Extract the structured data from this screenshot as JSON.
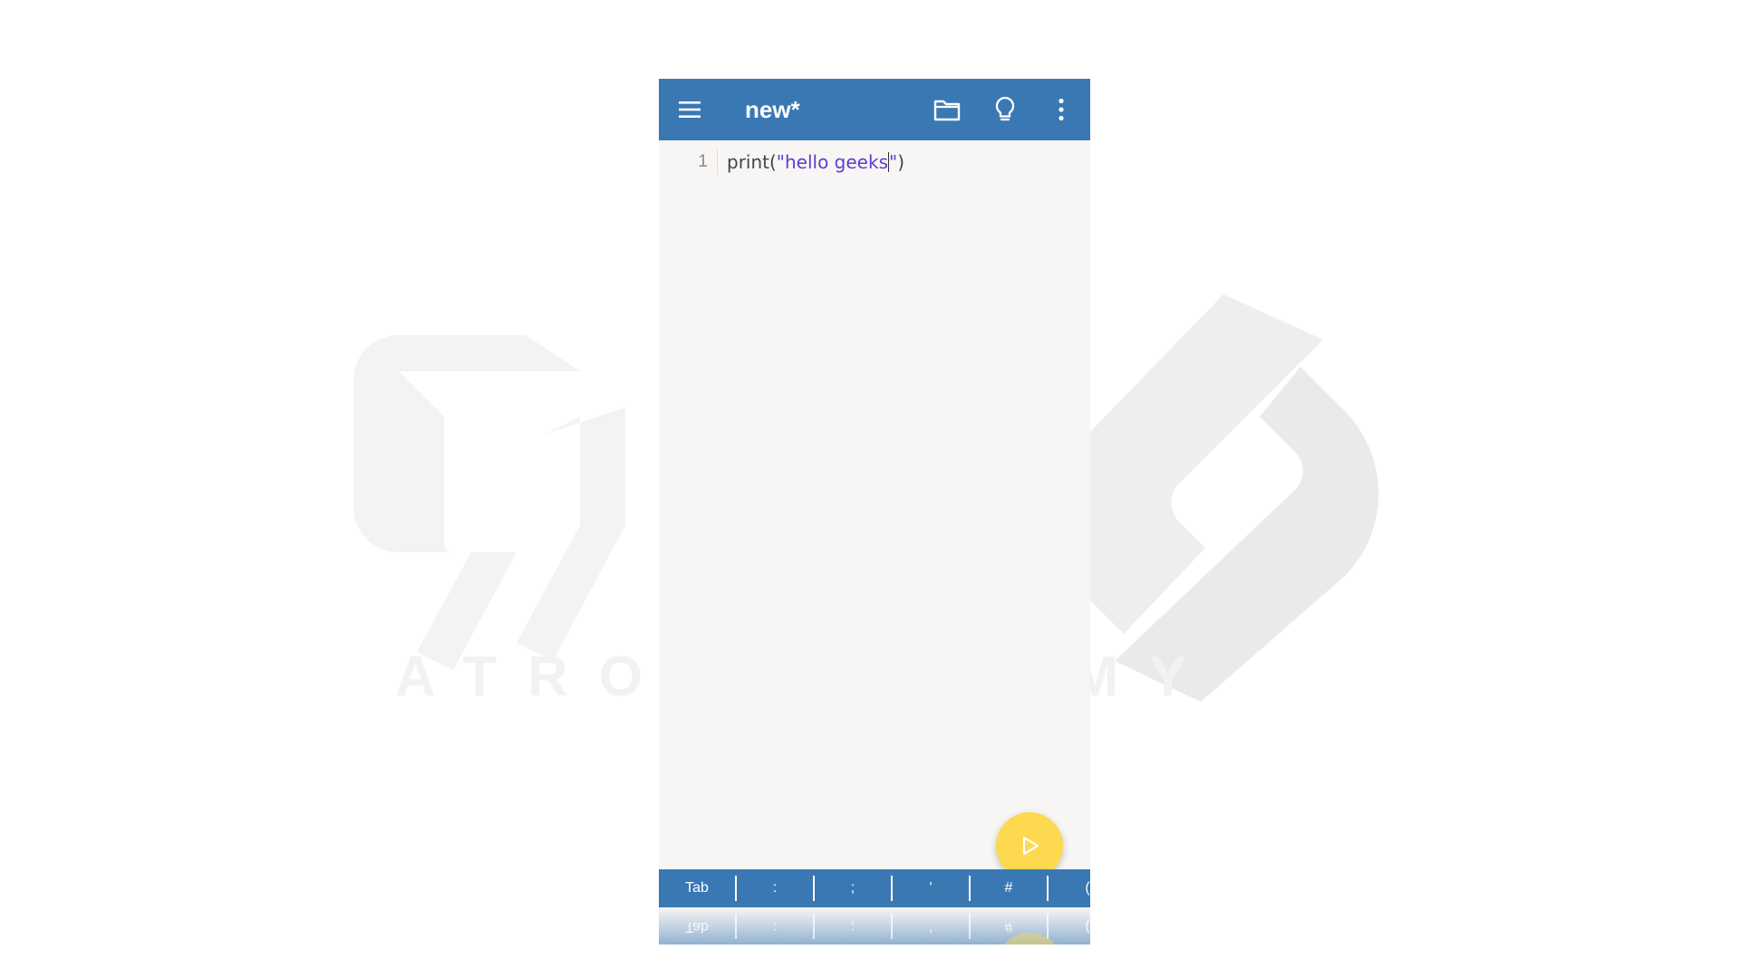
{
  "app": {
    "title": "new*"
  },
  "toolbar": {
    "icons": [
      "menu-icon",
      "folder-icon",
      "lightbulb-icon",
      "more-vert-icon"
    ]
  },
  "editor": {
    "lines": [
      {
        "number": "1",
        "code_prefix": "print(",
        "string": "\"hello geeks",
        "string_close": "\"",
        "code_suffix": ")"
      }
    ]
  },
  "keybar": {
    "keys": [
      "Tab",
      ":",
      ";",
      "'",
      "#",
      "("
    ]
  },
  "watermark": {
    "text": "ATRO ACADEMY"
  },
  "colors": {
    "appbar": "#3a78b4",
    "fab": "#fcd94e",
    "string": "#5b3fd0",
    "editor_bg": "#f8f5f3"
  }
}
